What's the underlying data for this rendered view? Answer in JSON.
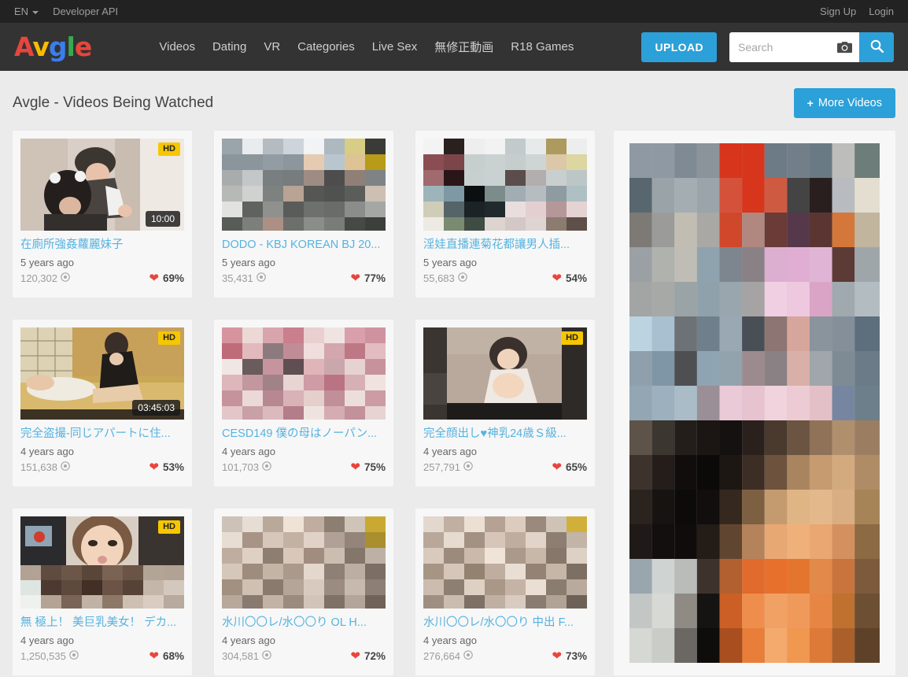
{
  "topbar": {
    "language": "EN",
    "developer_api": "Developer API",
    "sign_up": "Sign Up",
    "login": "Login"
  },
  "header": {
    "logo_letters": [
      "A",
      "v",
      "g",
      "l",
      "e"
    ],
    "nav": [
      {
        "label": "Videos"
      },
      {
        "label": "Dating"
      },
      {
        "label": "VR"
      },
      {
        "label": "Categories"
      },
      {
        "label": "Live Sex"
      },
      {
        "label": "無修正動画"
      },
      {
        "label": "R18 Games"
      }
    ],
    "upload_label": "UPLOAD",
    "search_placeholder": "Search",
    "search_value": "",
    "camera_icon": "camera-icon",
    "search_icon": "search-icon"
  },
  "page": {
    "title": "Avgle - Videos Being Watched",
    "more_videos_label": "More Videos",
    "more_videos_plus": "+"
  },
  "colors": {
    "accent": "#2ca0d8",
    "link": "#55b3e0",
    "hd_badge": "#f6c700",
    "heart": "#e8453c",
    "header_bg": "#333333",
    "topbar_bg": "#222222",
    "page_bg": "#ebebeb",
    "card_bg": "#f7f7f7"
  },
  "videos": [
    {
      "title": "在廁所強姦蘿麗妹子",
      "age": "5 years ago",
      "views": "120,302",
      "rating": "69%",
      "duration": "10:00",
      "hd": "HD",
      "thumb_style": "photo-girl-bathroom"
    },
    {
      "title": "DODO - KBJ KOREAN BJ 20...",
      "age": "5 years ago",
      "views": "35,431",
      "rating": "77%",
      "duration": "",
      "hd": "",
      "thumb_style": "pixel-gray"
    },
    {
      "title": "淫娃直播連菊花都讓男人插...",
      "age": "5 years ago",
      "views": "55,683",
      "rating": "54%",
      "duration": "",
      "hd": "",
      "thumb_style": "pixel-pale"
    },
    {
      "title": "完全盗撮-同じアパートに住...",
      "age": "4 years ago",
      "views": "151,638",
      "rating": "53%",
      "duration": "03:45:03",
      "hd": "HD",
      "thumb_style": "photo-room-tatami"
    },
    {
      "title": "CESD149 僕の母はノーパン...",
      "age": "4 years ago",
      "views": "101,703",
      "rating": "75%",
      "duration": "",
      "hd": "",
      "thumb_style": "pixel-pink"
    },
    {
      "title": "完全顔出し♥神乳24歳Ｓ級...",
      "age": "4 years ago",
      "views": "257,791",
      "rating": "65%",
      "duration": "",
      "hd": "HD",
      "thumb_style": "photo-woman-bed"
    },
    {
      "title": "無 極上！ 美巨乳美女！ デカ...",
      "age": "4 years ago",
      "views": "1,250,535",
      "rating": "68%",
      "duration": "",
      "hd": "HD",
      "thumb_style": "photo-face-office"
    },
    {
      "title": "水川〇〇レ/水〇〇り OL H...",
      "age": "4 years ago",
      "views": "304,581",
      "rating": "72%",
      "duration": "",
      "hd": "",
      "thumb_style": "pixel-skin"
    },
    {
      "title": "水川〇〇レ/水〇〇り 中出 F...",
      "age": "4 years ago",
      "views": "276,664",
      "rating": "73%",
      "duration": "",
      "hd": "",
      "thumb_style": "pixel-skin2"
    }
  ],
  "side_panel": {
    "name": "promotional-banner"
  }
}
